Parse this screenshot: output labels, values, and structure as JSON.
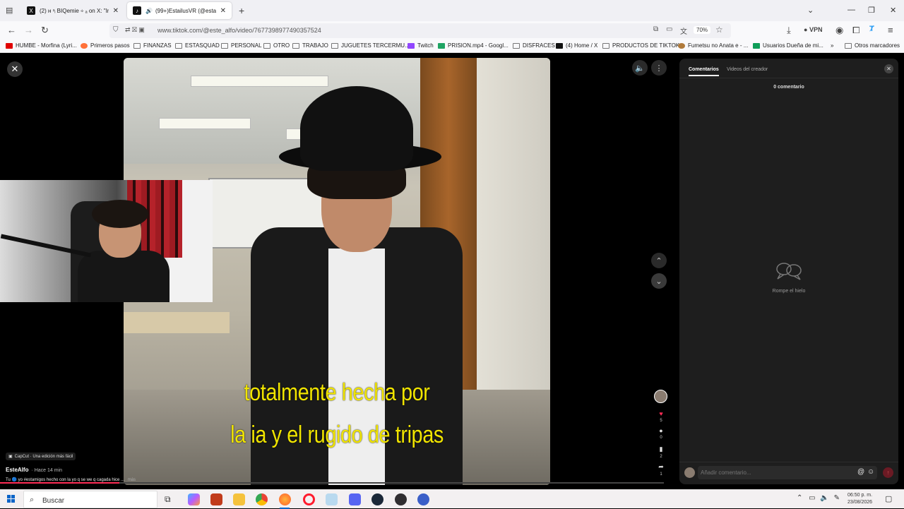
{
  "browser": {
    "tabs": [
      {
        "title": "(2) ʜ ᵌᵢ BIQemie ÷ ₐ on X: \"Intr",
        "favicon": "X",
        "active": false
      },
      {
        "title": "(99+)EstailusVR (@estailus",
        "favicon": "♪",
        "active": true
      }
    ],
    "new_tab_label": "+",
    "url": "www.tiktok.com/@este_alfo/video/7677398977490357524",
    "zoom": "70%",
    "vpn_label": "VPN",
    "bookmarks": [
      {
        "label": "HUMBE - Morfina (Lyri...",
        "color": "#e00000"
      },
      {
        "label": "Primeros pasos",
        "color": "#ff7139"
      },
      {
        "label": "FINANZAS",
        "color": "#888"
      },
      {
        "label": "ESTASQUAD",
        "color": "#888"
      },
      {
        "label": "PERSONAL",
        "color": "#888"
      },
      {
        "label": "OTRO",
        "color": "#888"
      },
      {
        "label": "TRABAJO",
        "color": "#888"
      },
      {
        "label": "JUGUETES TERCERMU...",
        "color": "#888"
      },
      {
        "label": "Twitch",
        "color": "#9146ff"
      },
      {
        "label": "PRISION.mp4 - Googl...",
        "color": "#1fa463"
      },
      {
        "label": "DISFRACES",
        "color": "#888"
      },
      {
        "label": "(4) Home / X",
        "color": "#111"
      },
      {
        "label": "PRODUCTOS DE TIKTOK",
        "color": "#888"
      },
      {
        "label": "Fumetsu no Anata e - ...",
        "color": "#b07a3a"
      },
      {
        "label": "Usuarios Dueña de mi...",
        "color": "#0f9d58"
      },
      {
        "label": "Otros marcadores",
        "color": "#888"
      }
    ]
  },
  "video": {
    "captions": [
      "totalmente hecha por",
      "la ia y el rugido de tripas"
    ],
    "progress": 0.18
  },
  "actions": {
    "likes": "5",
    "comments": "0",
    "saves": "2",
    "shares": "1"
  },
  "post": {
    "capcut_label": "CapCut · Una edición más fácil",
    "author": "EsteAlfo",
    "time": "· Hace 14 min",
    "description": "Tu 🔵 yo #estamigos hecho con la yo q se we q cagada hice ...",
    "more": "más"
  },
  "comments_panel": {
    "tab_comments": "Comentarios",
    "tab_creator_videos": "Videos del creador",
    "count_label": "0 comentario",
    "empty_label": "Rompe el hielo",
    "input_placeholder": "Añadir comentario..."
  },
  "taskbar": {
    "search_label": "Buscar",
    "time": "06:50 p. m.",
    "date": "23/08/2026"
  },
  "colors": {
    "accent": "#fe2c55",
    "caption": "#f0e400"
  }
}
